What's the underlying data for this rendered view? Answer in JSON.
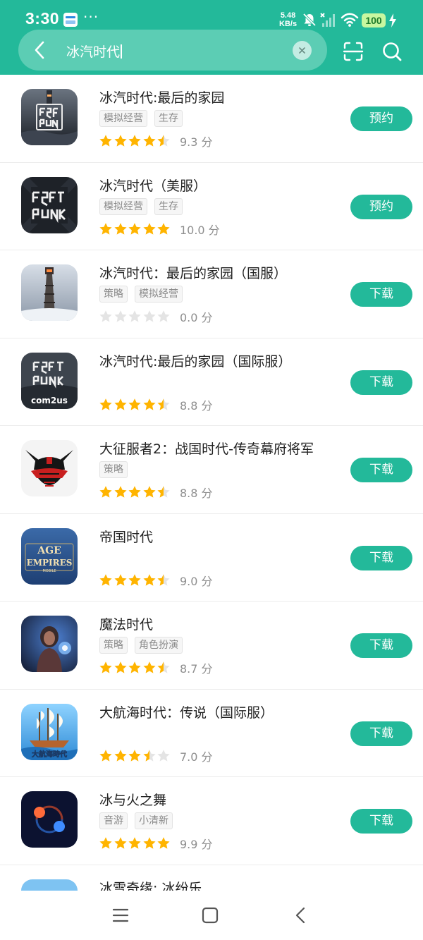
{
  "status_bar": {
    "time": "3:30",
    "more": "···",
    "net_speed_value": "5.48",
    "net_speed_unit": "KB/s",
    "battery": "100"
  },
  "search": {
    "query": "冰汽时代",
    "back_icon": "chevron-left-icon",
    "clear_icon": "close-icon",
    "scan_icon": "scan-icon",
    "search_icon": "search-icon"
  },
  "colors": {
    "brand": "#23b99a",
    "star_filled": "#ffb400",
    "star_empty": "#e4e4e4"
  },
  "results": [
    {
      "title": "冰汽时代:最后的家园",
      "tags": [
        "模拟经营",
        "生存"
      ],
      "stars": 4.5,
      "score": "9.3 分",
      "action": "预约"
    },
    {
      "title": "冰汽时代（美服）",
      "tags": [
        "模拟经营",
        "生存"
      ],
      "stars": 5,
      "score": "10.0 分",
      "action": "预约"
    },
    {
      "title": "冰汽时代：最后的家园（国服）",
      "tags": [
        "策略",
        "模拟经营"
      ],
      "stars": 0,
      "score": "0.0 分",
      "action": "下载"
    },
    {
      "title": "冰汽时代:最后的家园（国际服）",
      "tags": [],
      "stars": 4.5,
      "score": "8.8 分",
      "action": "下载",
      "icon_text": "com2us"
    },
    {
      "title": "大征服者2：战国时代-传奇幕府将军",
      "tags": [
        "策略"
      ],
      "stars": 4.5,
      "score": "8.8 分",
      "action": "下载"
    },
    {
      "title": "帝国时代",
      "tags": [],
      "stars": 4.5,
      "score": "9.0 分",
      "action": "下载",
      "icon_text": "AGE EMPIRES MOBILE"
    },
    {
      "title": "魔法时代",
      "tags": [
        "策略",
        "角色扮演"
      ],
      "stars": 4.5,
      "score": "8.7 分",
      "action": "下载"
    },
    {
      "title": "大航海时代：传说（国际服）",
      "tags": [],
      "stars": 3.5,
      "score": "7.0 分",
      "action": "下载",
      "icon_text": "大航海時代"
    },
    {
      "title": "冰与火之舞",
      "tags": [
        "音游",
        "小清新"
      ],
      "stars": 5,
      "score": "9.9 分",
      "action": "下载"
    },
    {
      "title": "冰雪奇缘: 冰纷乐",
      "tags": [],
      "stars": 0,
      "score": "",
      "action": ""
    }
  ],
  "bottom_nav": {
    "menu_icon": "menu-icon",
    "home_icon": "home-icon",
    "back_icon": "back-icon"
  }
}
